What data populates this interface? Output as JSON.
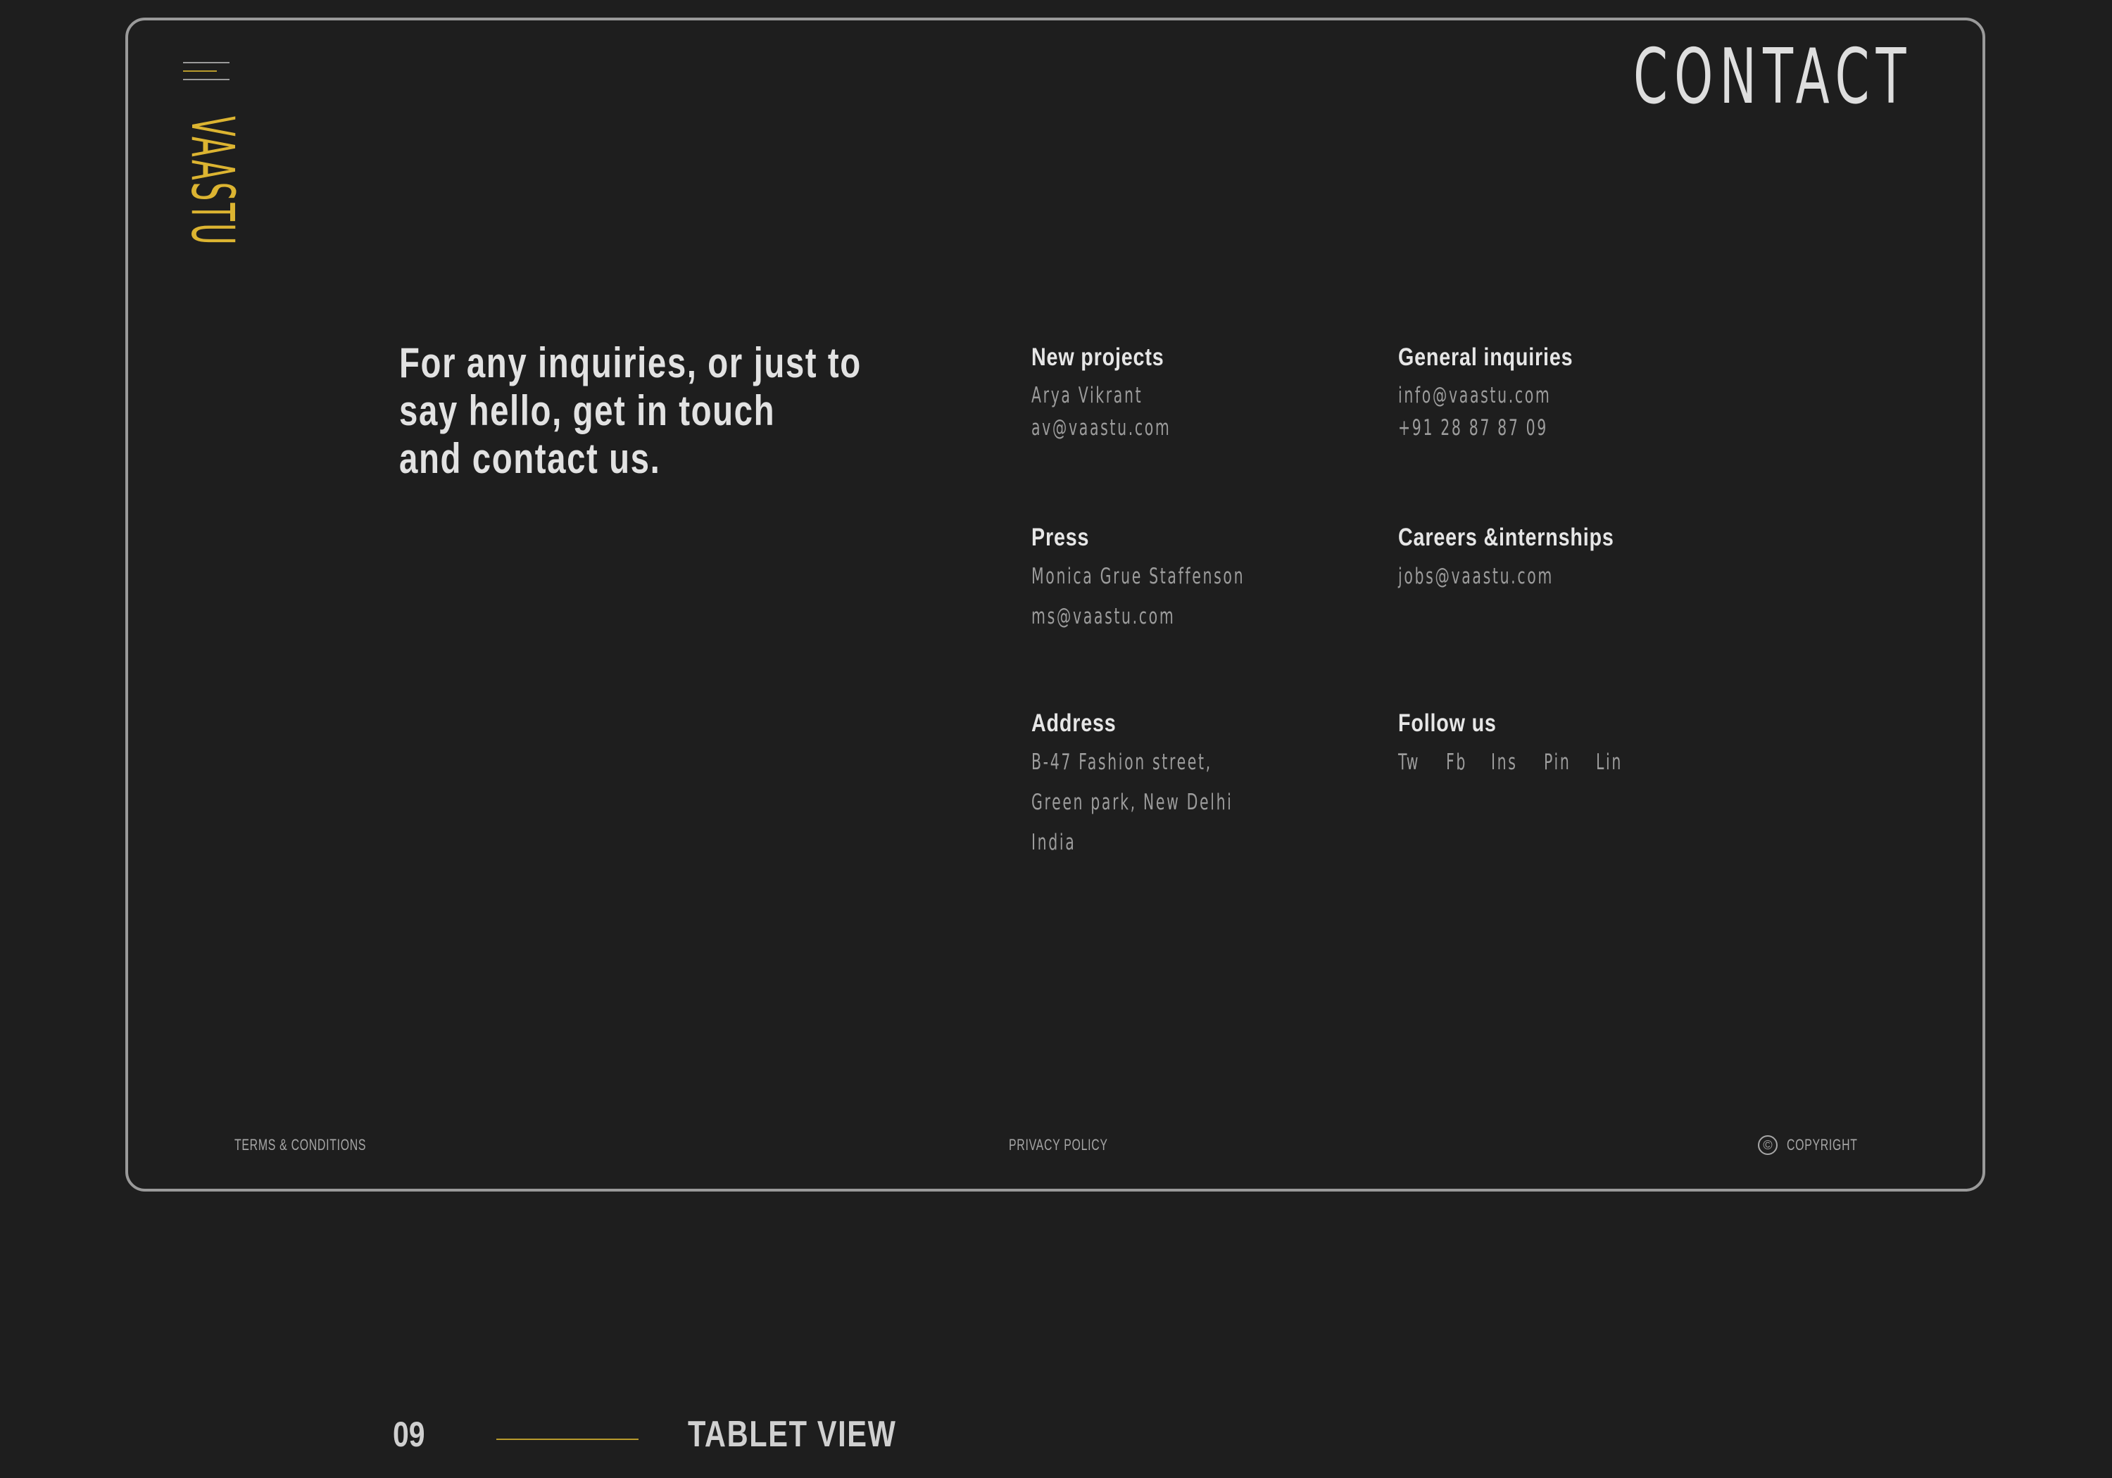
{
  "brand": {
    "name": "VAASTU",
    "accent_color": "#dcb431"
  },
  "header": {
    "menu_icon": "hamburger-menu-icon",
    "title": "CONTACT"
  },
  "intro": {
    "lines": [
      "For any inquiries, or just to",
      "say hello, get in touch",
      "and contact us."
    ]
  },
  "contacts": {
    "new_projects": {
      "heading": "New projects",
      "lines": [
        "Arya Vikrant",
        "av@vaastu.com"
      ]
    },
    "general": {
      "heading": "General inquiries",
      "lines": [
        "info@vaastu.com",
        "+91 28 87 87 09"
      ]
    },
    "press": {
      "heading": "Press",
      "lines": [
        "Monica Grue Staffenson",
        "ms@vaastu.com"
      ]
    },
    "careers": {
      "heading": "Careers &internships",
      "lines": [
        "jobs@vaastu.com"
      ]
    },
    "address": {
      "heading": "Address",
      "lines": [
        "B-47 Fashion street,",
        "Green park, New Delhi",
        "India"
      ]
    },
    "follow": {
      "heading": "Follow us",
      "links": [
        "Tw",
        "Fb",
        "Ins",
        "Pin",
        "Lin"
      ]
    }
  },
  "footer": {
    "terms": "TERMS & CONDITIONS",
    "privacy": "PRIVACY POLICY",
    "copyright": "COPYRIGHT",
    "copyright_symbol": "©"
  },
  "section": {
    "number": "09",
    "title": "TABLET VIEW"
  }
}
